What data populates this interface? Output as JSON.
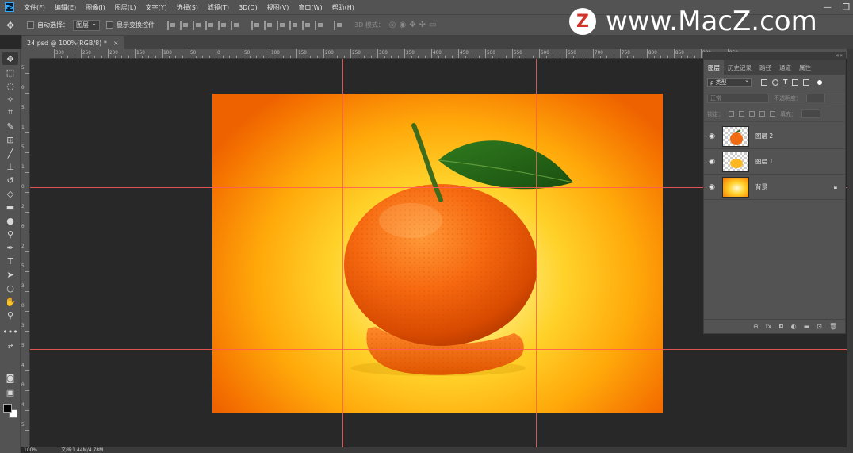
{
  "menu": {
    "logo": "Ps",
    "items": [
      "文件(F)",
      "编辑(E)",
      "图像(I)",
      "图层(L)",
      "文字(Y)",
      "选择(S)",
      "滤镜(T)",
      "3D(D)",
      "视图(V)",
      "窗口(W)",
      "帮助(H)"
    ],
    "window_controls": [
      "—",
      "❐"
    ]
  },
  "options": {
    "auto_select_label": "自动选择：",
    "auto_select_value": "图层",
    "show_transform_label": "显示变换控件",
    "mode_3d_label": "3D 模式："
  },
  "watermark": {
    "badge": "Z",
    "text": "www.MacZ.com"
  },
  "document": {
    "tab_title": "24.psd @ 100%(RGB/8) *",
    "tab_close": "×"
  },
  "ruler": {
    "top_labels": [
      "300",
      "250",
      "200",
      "150",
      "100",
      "50",
      "0",
      "50",
      "100",
      "150",
      "200",
      "250",
      "300",
      "350",
      "400",
      "450",
      "500",
      "550",
      "600",
      "650",
      "700",
      "750",
      "800",
      "850",
      "900",
      "950"
    ],
    "left_labels": [
      "5",
      "0",
      "5",
      "1",
      "5",
      "1",
      "0",
      "2",
      "0",
      "2",
      "5",
      "3",
      "0",
      "3",
      "5",
      "4",
      "0",
      "4",
      "5"
    ]
  },
  "status": {
    "zoom": "100%",
    "doc_size": "文档:1.44M/4.78M"
  },
  "layers_panel": {
    "collapse": "««",
    "tabs": [
      "图层",
      "历史记录",
      "路径",
      "通道",
      "属性"
    ],
    "active_tab": 0,
    "filter_kind": "ρ 类型",
    "blend_mode": "正常",
    "opacity_label": "不透明度：",
    "lock_label": "锁定：",
    "fill_label": "填充：",
    "layers": [
      {
        "name": "图层 2",
        "visible": true,
        "locked": false
      },
      {
        "name": "图层 1",
        "visible": true,
        "locked": false
      },
      {
        "name": "背景",
        "visible": true,
        "locked": true
      }
    ],
    "footer_icons": [
      "link-icon",
      "fx-icon",
      "mask-icon",
      "adjustment-icon",
      "folder-icon",
      "new-layer-icon",
      "trash-icon"
    ]
  },
  "colors": {
    "ui_panel": "#535353",
    "canvas_bg": "#282828",
    "guide": "#ff5a5a",
    "foreground": "#000000",
    "background": "#ffffff"
  }
}
